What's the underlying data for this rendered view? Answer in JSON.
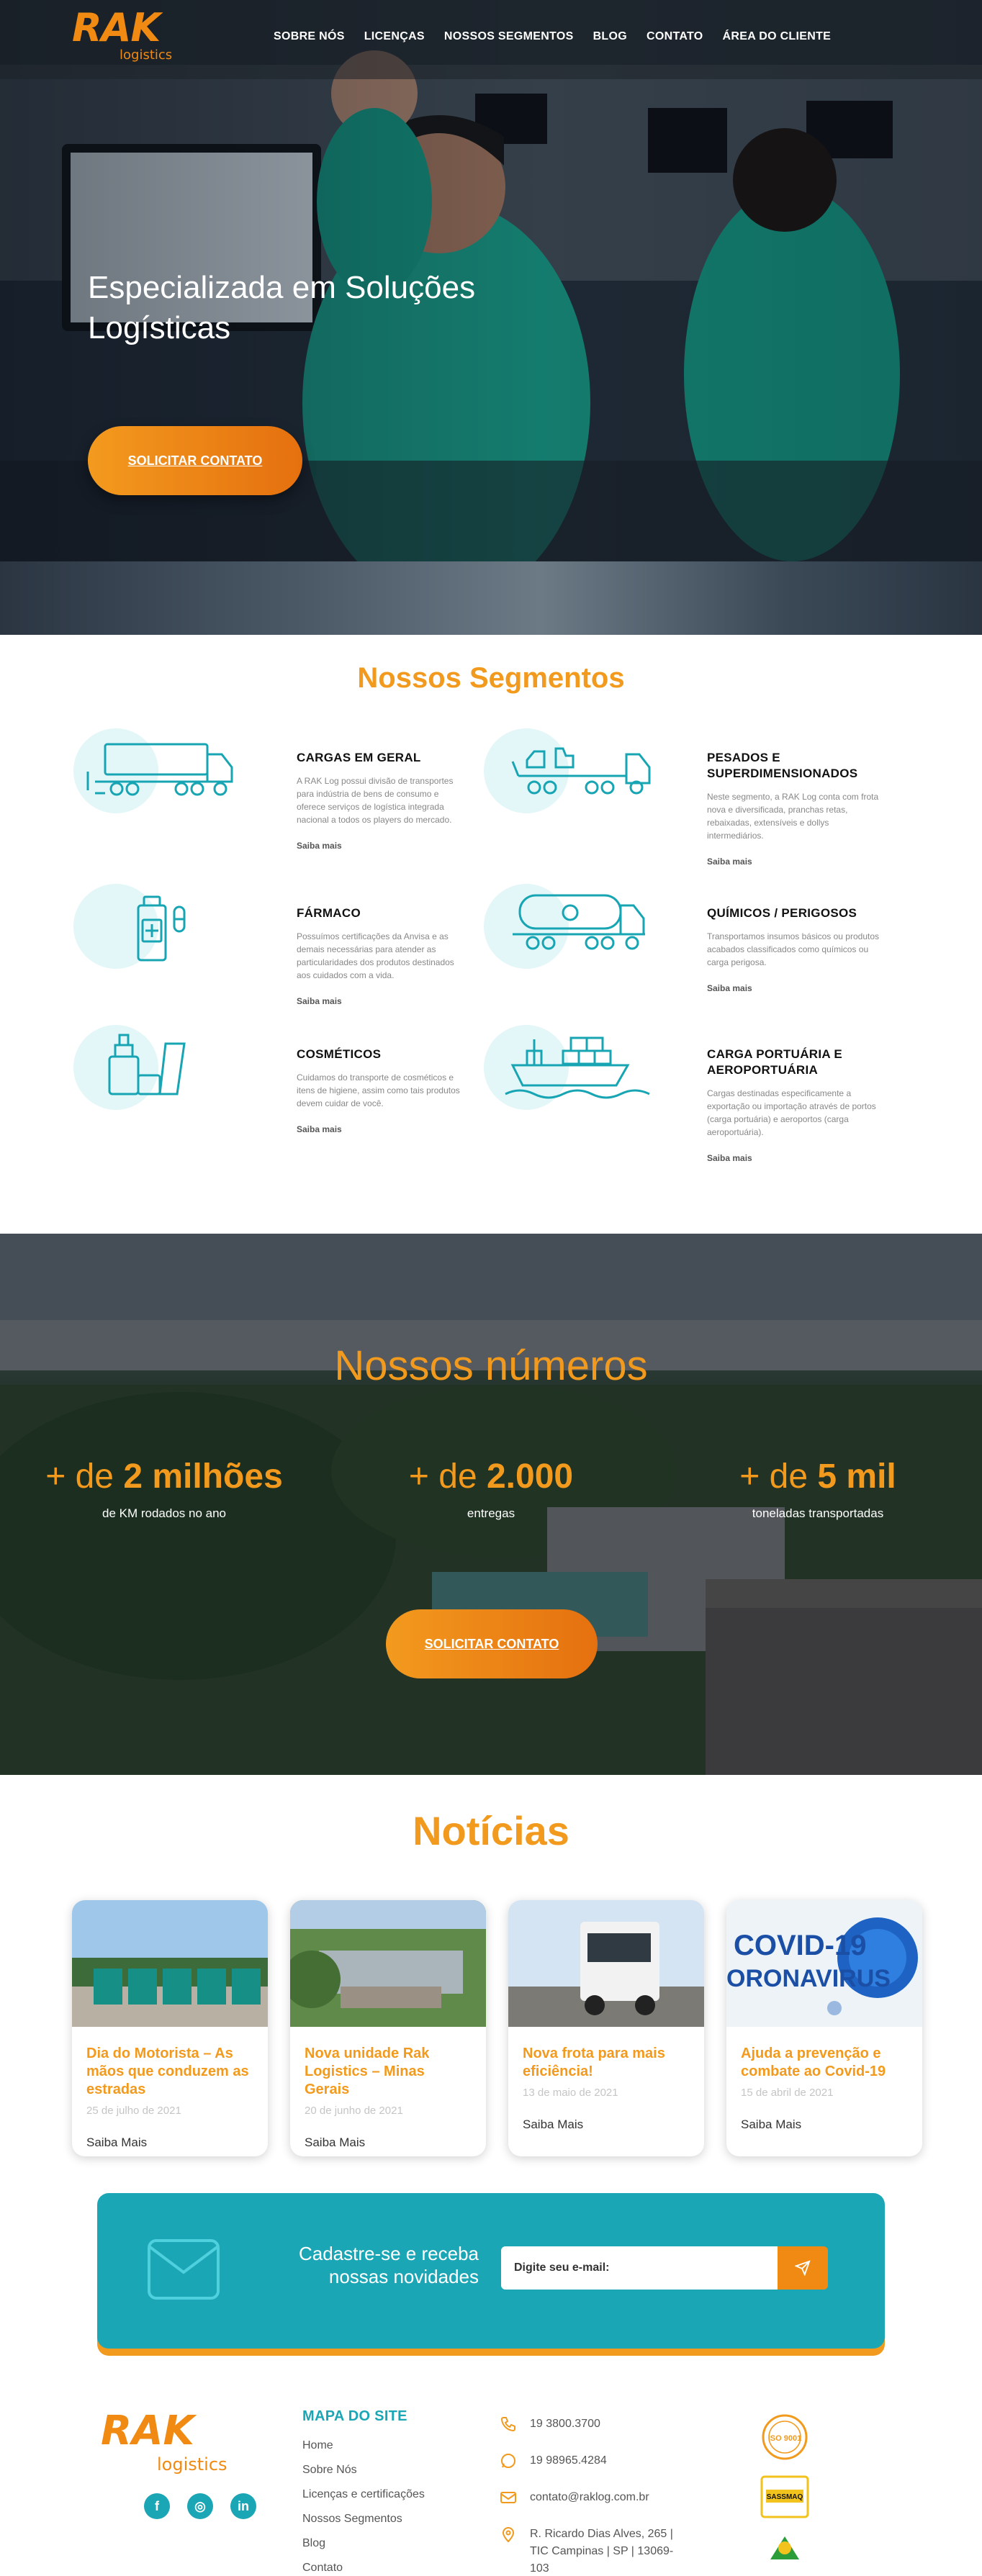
{
  "header": {
    "logo_mark": "RAK",
    "logo_sub": "logistics",
    "nav": [
      "SOBRE NÓS",
      "LICENÇAS",
      "NOSSOS SEGMENTOS",
      "BLOG",
      "CONTATO",
      "ÁREA DO CLIENTE"
    ]
  },
  "hero": {
    "title": "Especializada em Soluções Logísticas",
    "cta": "SOLICITAR CONTATO"
  },
  "segments": {
    "title": "Nossos Segmentos",
    "items": [
      {
        "icon": "truck-icon",
        "title": "CARGAS EM GERAL",
        "text": "A RAK Log possui divisão de transportes para indústria de bens de consumo e oferece serviços de logística integrada nacional a todos os players do mercado.",
        "more": "Saiba mais"
      },
      {
        "icon": "heavy-load-icon",
        "title": "PESADOS E SUPERDIMENSIONADOS",
        "text": "Neste segmento, a RAK Log conta com frota nova e diversificada, pranchas retas, rebaixadas, extensíveis e dollys intermediários.",
        "more": "Saiba mais"
      },
      {
        "icon": "pharmacy-icon",
        "title": "FÁRMACO",
        "text": "Possuímos certificações da Anvisa e as demais necessárias para atender as particularidades dos produtos destinados aos cuidados com a vida.",
        "more": "Saiba mais"
      },
      {
        "icon": "tanker-truck-icon",
        "title": "QUÍMICOS / PERIGOSOS",
        "text": "Transportamos insumos básicos ou produtos acabados classificados como químicos ou carga perigosa.",
        "more": "Saiba mais"
      },
      {
        "icon": "cosmetics-icon",
        "title": "COSMÉTICOS",
        "text": "Cuidamos do transporte de cosméticos e itens de higiene, assim como tais produtos devem cuidar de você.",
        "more": "Saiba mais"
      },
      {
        "icon": "cargo-ship-icon",
        "title": "CARGA PORTUÁRIA E AEROPORTUÁRIA",
        "text": "Cargas destinadas especificamente a exportação ou importação através de portos (carga portuária) e aeroportos (carga aeroportuária).",
        "more": "Saiba mais"
      }
    ]
  },
  "numbers": {
    "title": "Nossos números",
    "stats": [
      {
        "prefix": "+ de",
        "value": "2 milhões",
        "label": "de KM rodados no ano"
      },
      {
        "prefix": "+ de",
        "value": "2.000",
        "label": "entregas"
      },
      {
        "prefix": "+ de",
        "value": "5 mil",
        "label": "toneladas transportadas"
      }
    ],
    "cta": "SOLICITAR CONTATO"
  },
  "news": {
    "title": "Notícias",
    "cards": [
      {
        "title": "Dia do Motorista – As mãos que conduzem as estradas",
        "date": "25 de julho de 2021",
        "more": "Saiba Mais"
      },
      {
        "title": "Nova unidade Rak Logistics – Minas Gerais",
        "date": "20 de junho de 2021",
        "more": "Saiba Mais"
      },
      {
        "title": "Nova frota para mais eficiência!",
        "date": "13 de maio de 2021",
        "more": "Saiba Mais"
      },
      {
        "title": "Ajuda a prevenção e combate ao Covid-19",
        "date": "15 de abril de 2021",
        "more": "Saiba Mais",
        "thumb_text_1": "COVID-19",
        "thumb_text_2": "ORONAVIRUS"
      }
    ]
  },
  "newsletter": {
    "text": "Cadastre-se e receba nossas novidades",
    "placeholder": "Digite seu e-mail:"
  },
  "footer": {
    "logo_mark": "RAK",
    "logo_sub": "logistics",
    "sitemap_title": "MAPA DO SITE",
    "sitemap": [
      "Home",
      "Sobre Nós",
      "Licenças e certificações",
      "Nossos Segmentos",
      "Blog",
      "Contato"
    ],
    "phone": "19 3800.3700",
    "whatsapp": "19 98965.4284",
    "email": "contato@raklog.com.br",
    "address": "R. Ricardo Dias Alves, 265 | TIC Campinas | SP | 13069-103",
    "certs": [
      "ISO 9001",
      "SASSMAQ"
    ]
  },
  "colors": {
    "orange": "#f29a1d",
    "teal": "#1ba6b6"
  }
}
